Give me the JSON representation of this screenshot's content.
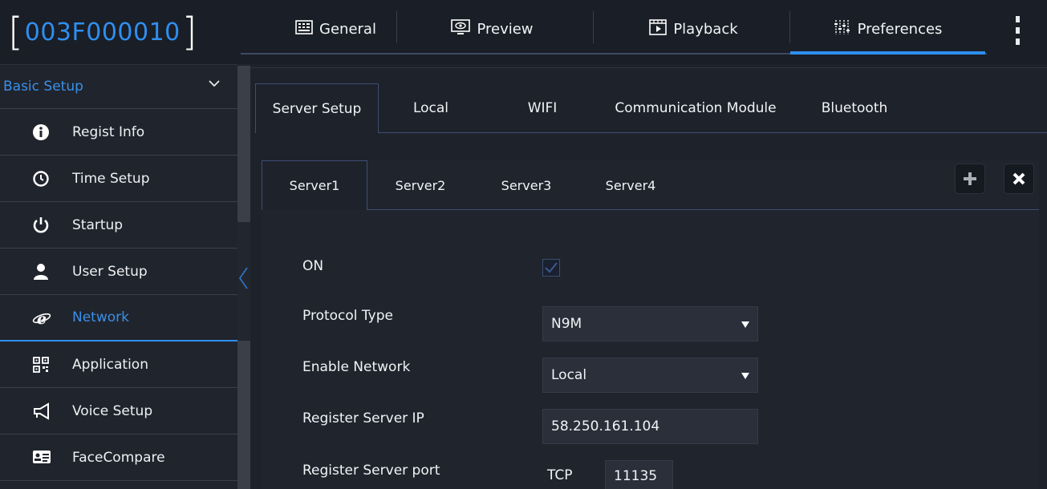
{
  "header": {
    "device_id": "003F000010",
    "tabs": [
      {
        "label": "General",
        "icon": "general-icon"
      },
      {
        "label": "Preview",
        "icon": "preview-icon"
      },
      {
        "label": "Playback",
        "icon": "playback-icon"
      },
      {
        "label": "Preferences",
        "icon": "preferences-icon",
        "active": true
      }
    ]
  },
  "sidebar": {
    "section_label": "Basic Setup",
    "items": [
      {
        "label": "Regist Info",
        "icon": "info-icon"
      },
      {
        "label": "Time Setup",
        "icon": "clock-icon"
      },
      {
        "label": "Startup",
        "icon": "power-icon"
      },
      {
        "label": "User Setup",
        "icon": "user-icon"
      },
      {
        "label": "Network",
        "icon": "network-icon",
        "active": true
      },
      {
        "label": "Application",
        "icon": "qr-icon"
      },
      {
        "label": "Voice Setup",
        "icon": "megaphone-icon"
      },
      {
        "label": "FaceCompare",
        "icon": "id-card-icon"
      }
    ]
  },
  "main": {
    "tabs": [
      "Server Setup",
      "Local",
      "WIFI",
      "Communication Module",
      "Bluetooth"
    ],
    "server_tabs": [
      "Server1",
      "Server2",
      "Server3",
      "Server4"
    ],
    "form": {
      "on_label": "ON",
      "on_checked": true,
      "protocol_label": "Protocol Type",
      "protocol_value": "N9M",
      "enable_network_label": "Enable Network",
      "enable_network_value": "Local",
      "server_ip_label": "Register Server IP",
      "server_ip_value": "58.250.161.104",
      "server_port_label": "Register Server port",
      "port_protocol": "TCP",
      "port_value": "11135"
    }
  },
  "colors": {
    "accent": "#2f8ff0",
    "background": "#1c2029"
  }
}
